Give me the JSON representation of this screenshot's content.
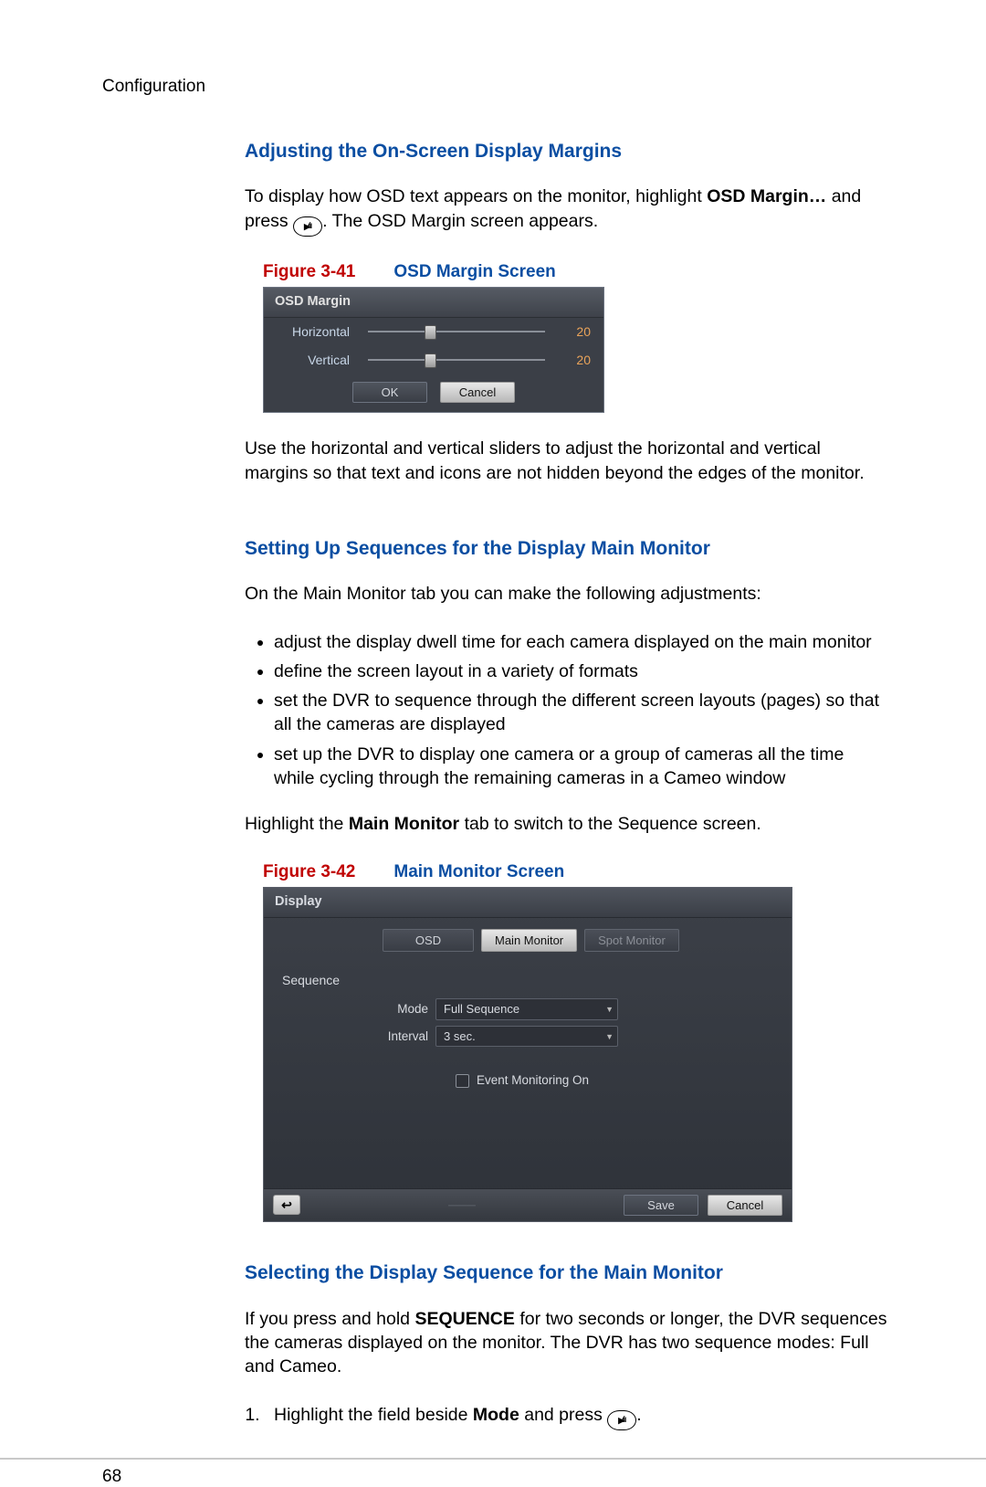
{
  "header": "Configuration",
  "page_number": "68",
  "s1": {
    "heading": "Adjusting the On-Screen Display Margins",
    "p1_a": "To display how OSD text appears on the monitor, highlight ",
    "p1_bold": "OSD Margin…",
    "p1_b": " and press ",
    "p1_c": ". The OSD Margin screen appears.",
    "fig": {
      "num": "Figure 3-41",
      "title": "OSD Margin Screen"
    },
    "osd": {
      "title": "OSD Margin",
      "rows": [
        {
          "label": "Horizontal",
          "value": "20",
          "pos": 32
        },
        {
          "label": "Vertical",
          "value": "20",
          "pos": 32
        }
      ],
      "ok": "OK",
      "cancel": "Cancel"
    },
    "p2": "Use the horizontal and vertical sliders to adjust the horizontal and vertical margins so that text and icons are not hidden beyond the edges of the monitor."
  },
  "s2": {
    "heading": "Setting Up Sequences for the Display Main Monitor",
    "p1": "On the Main Monitor tab you can make the following adjustments:",
    "bullets": [
      "adjust the display dwell time for each camera displayed on the main monitor",
      "define the screen layout in a variety of formats",
      "set the DVR to sequence through the different screen layouts (pages) so that all the cameras are displayed",
      "set up the DVR to display one camera or a group of cameras all the time while cycling through the remaining cameras in a Cameo window"
    ],
    "p2_a": "Highlight the ",
    "p2_bold": "Main Monitor",
    "p2_b": " tab to switch to the Sequence screen.",
    "fig": {
      "num": "Figure 3-42",
      "title": "Main Monitor Screen"
    },
    "dvr": {
      "title": "Display",
      "tabs": {
        "osd": "OSD",
        "main": "Main Monitor",
        "spot": "Spot Monitor"
      },
      "section": "Sequence",
      "mode_label": "Mode",
      "mode_value": "Full Sequence",
      "interval_label": "Interval",
      "interval_value": "3 sec.",
      "event_label": "Event Monitoring On",
      "save": "Save",
      "cancel": "Cancel"
    }
  },
  "s3": {
    "heading": "Selecting the Display Sequence for the Main Monitor",
    "p1_a": "If you press and hold ",
    "p1_bold": "SEQUENCE",
    "p1_b": " for two seconds or longer, the DVR sequences the cameras displayed on the monitor. The DVR has two sequence modes: Full and Cameo.",
    "step1_a": "Highlight the field beside ",
    "step1_bold": "Mode",
    "step1_b": " and press ",
    "step1_c": "."
  }
}
